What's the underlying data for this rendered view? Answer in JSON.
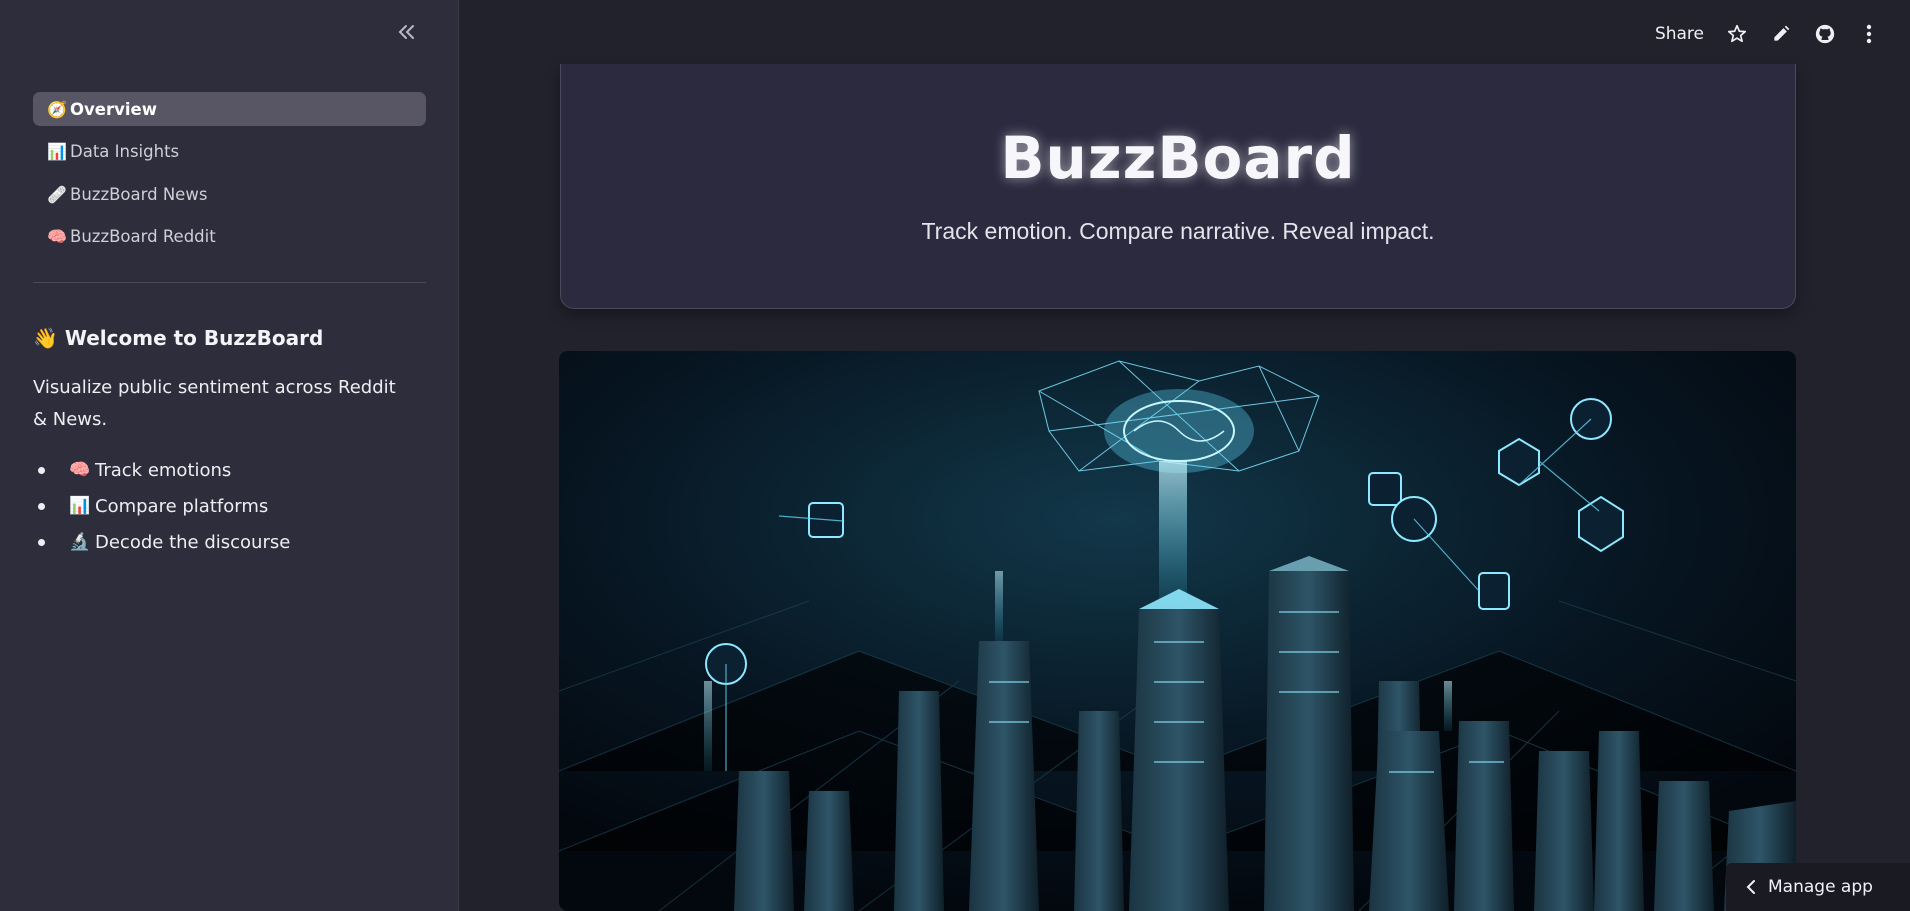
{
  "sidebar": {
    "collapse_icon": "double-chevron-left-icon",
    "nav": [
      {
        "emoji": "🧭",
        "label": "Overview",
        "active": true
      },
      {
        "emoji": "📊",
        "label": "Data Insights",
        "active": false
      },
      {
        "emoji": "🩹",
        "label": "BuzzBoard News",
        "active": false
      },
      {
        "emoji": "🧠",
        "label": "BuzzBoard Reddit",
        "active": false
      }
    ],
    "welcome": {
      "emoji": "👋",
      "title": "Welcome to BuzzBoard",
      "text": "Visualize public sentiment across Reddit & News.",
      "bullets": [
        {
          "emoji": "🧠",
          "text": "Track emotions"
        },
        {
          "emoji": "📊",
          "text": "Compare platforms"
        },
        {
          "emoji": "🔬",
          "text": "Decode the discourse"
        }
      ]
    }
  },
  "topbar": {
    "share_label": "Share",
    "icons": [
      "star-icon",
      "pencil-icon",
      "github-icon",
      "more-vertical-icon"
    ]
  },
  "hero": {
    "title": "BuzzBoard",
    "subtitle": "Track emotion. Compare narrative. Reveal impact."
  },
  "manage_app": {
    "label": "Manage app"
  },
  "colors": {
    "sidebar_bg": "#2e2d3b",
    "main_bg": "#22222d",
    "card_bg": "#2b2a3f",
    "active_nav": "#585665",
    "glow": "#7fe3ff"
  }
}
